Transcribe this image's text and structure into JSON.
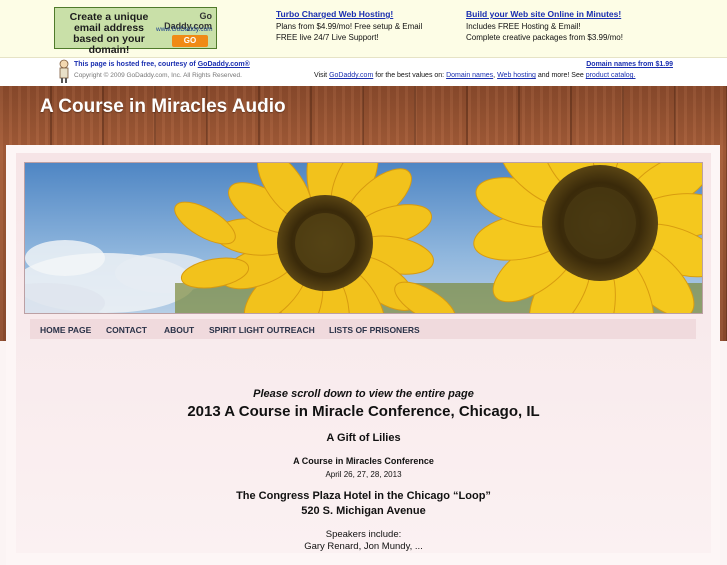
{
  "ad": {
    "text": "Create a unique email address based on your domain!",
    "logo": "Go Daddy.com",
    "url": "www.GoDaddy.com",
    "go": "GO"
  },
  "promo1": {
    "title": "Turbo Charged Web Hosting!",
    "line1": "Plans from $4.99/mo! Free setup & Email",
    "line2": "FREE live 24/7 Live Support!"
  },
  "promo2": {
    "title": "Build your Web site Online in Minutes!",
    "line1": "Includes FREE Hosting & Email!",
    "line2": "Complete creative packages from $3.99/mo!"
  },
  "hosted": {
    "prefix": "This page is hosted free, courtesy of",
    "link": "GoDaddy.com®",
    "copyright": "Copyright © 2009 GoDaddy.com, Inc. All Rights Reserved.",
    "domains_link": "Domain names from $1.99",
    "visit": "Visit",
    "godaddy": "GoDaddy.com",
    "best_values": "for the best values on:",
    "domain_names": "Domain names",
    "comma": ",",
    "web_hosting": "Web hosting",
    "and_more": "and more! See",
    "catalog": "product catalog."
  },
  "site": {
    "title": "A Course in Miracles Audio"
  },
  "nav": {
    "items": [
      "HOME PAGE",
      "CONTACT",
      "ABOUT",
      "SPIRIT LIGHT OUTREACH",
      "LISTS OF PRISONERS"
    ]
  },
  "content": {
    "scroll_note": "Please scroll down to view the entire page",
    "headline": "2013 A Course in Miracle Conference, Chicago, IL",
    "subhead": "A Gift of Lilies",
    "event": "A Course in Miracles Conference",
    "dates": "April 26, 27, 28, 2013",
    "venue": "The Congress Plaza Hotel in the Chicago “Loop”",
    "address": "520 S. Michigan Avenue",
    "speakers": "Speakers include:",
    "speakers_partial": "Gary Renard, Jon Mundy, ..."
  },
  "colors": {
    "wood": "#9a5634",
    "nav_text": "#2a3248",
    "link": "#1a2fb0",
    "banner_bg": "#fdfde6"
  }
}
